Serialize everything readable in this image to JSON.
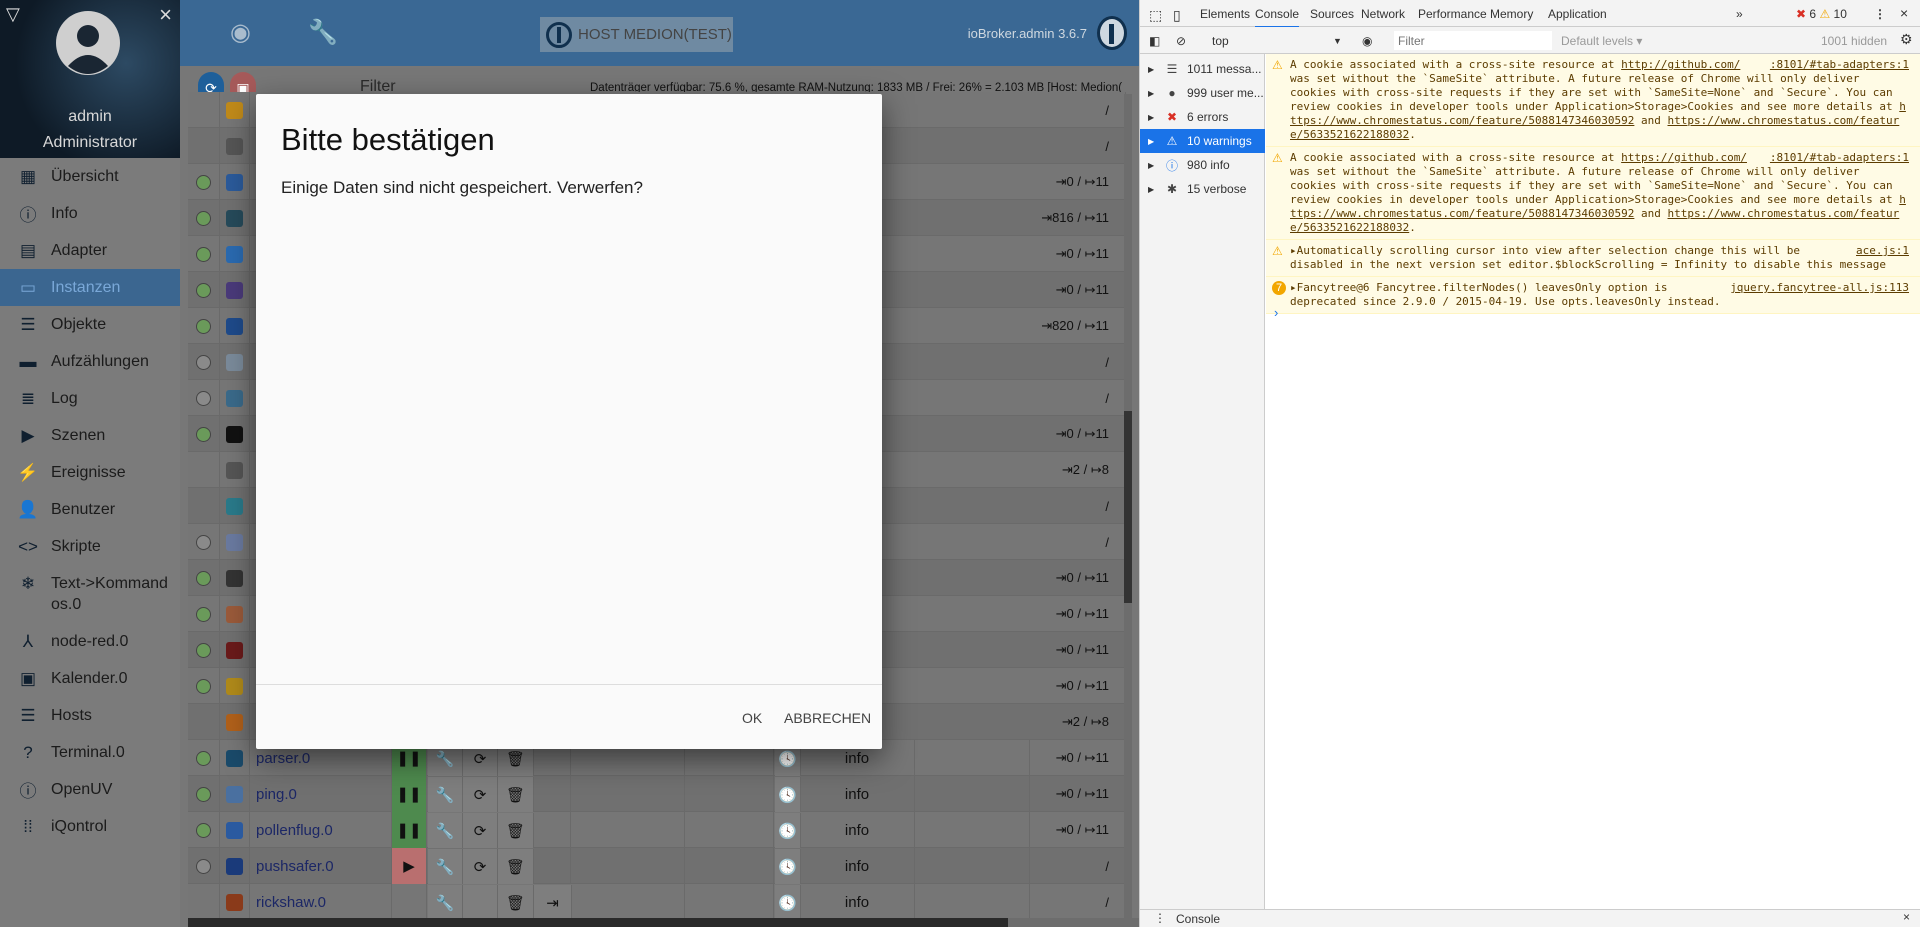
{
  "sidebar": {
    "user": "admin",
    "role": "Administrator",
    "items": [
      {
        "label": "Übersicht",
        "icon": "apps-icon",
        "g": "▦"
      },
      {
        "label": "Info",
        "icon": "info-icon",
        "g": "ⓘ"
      },
      {
        "label": "Adapter",
        "icon": "store-icon",
        "g": "▤"
      },
      {
        "label": "Instanzen",
        "icon": "instances-icon",
        "g": "▭",
        "active": true
      },
      {
        "label": "Objekte",
        "icon": "list-icon",
        "g": "☰"
      },
      {
        "label": "Aufzählungen",
        "icon": "enum-icon",
        "g": "▬"
      },
      {
        "label": "Log",
        "icon": "log-icon",
        "g": "≣"
      },
      {
        "label": "Szenen",
        "icon": "scenes-icon",
        "g": "▶"
      },
      {
        "label": "Ereignisse",
        "icon": "flash-icon",
        "g": "⚡"
      },
      {
        "label": "Benutzer",
        "icon": "user-icon",
        "g": "👤"
      },
      {
        "label": "Skripte",
        "icon": "code-icon",
        "g": "<>"
      },
      {
        "label": "Text->Kommandos.0",
        "icon": "snowflake-icon",
        "g": "❄",
        "two": true
      },
      {
        "label": "node-red.0",
        "icon": "node-red-icon",
        "g": "⅄"
      },
      {
        "label": "Kalender.0",
        "icon": "calendar-icon",
        "g": "▣"
      },
      {
        "label": "Hosts",
        "icon": "hosts-icon",
        "g": "☰"
      },
      {
        "label": "Terminal.0",
        "icon": "terminal-icon",
        "g": "?"
      },
      {
        "label": "OpenUV",
        "icon": "info-icon",
        "g": "ⓘ"
      },
      {
        "label": "iQontrol",
        "icon": "grid-dots-icon",
        "g": "⁞⁞"
      }
    ]
  },
  "header": {
    "host_label": "HOST MEDION(TEST)",
    "version": "ioBroker.admin 3.6.7"
  },
  "toolbar": {
    "filter_label": "Filter",
    "stats": "Datenträger verfügbar: 75.6 %, gesamte RAM-Nutzung: 1833 MB / Frei: 26% = 2.103 MB [Host: Medion("
  },
  "colors": {
    "green": "#6a9a5a",
    "grey": "#8a8a8a",
    "pause": "#4e8a4e",
    "play": "#b96f6f",
    "header": "#3a6894"
  },
  "rows": [
    {
      "status": "none",
      "icon": "#c08a1a",
      "values": "/"
    },
    {
      "status": "none",
      "icon": "#555",
      "values": "/"
    },
    {
      "status": "green",
      "icon": "#2b5a9a",
      "values": "⇥0 / ↦11"
    },
    {
      "status": "green",
      "icon": "#264a5a",
      "values": "⇥816 / ↦11"
    },
    {
      "status": "green",
      "icon": "#2a6ab0",
      "values": "⇥0 / ↦11"
    },
    {
      "status": "green",
      "icon": "#4a3a7a",
      "values": "⇥0 / ↦11"
    },
    {
      "status": "green",
      "icon": "#1e4a8a",
      "values": "⇥820 / ↦11"
    },
    {
      "status": "grey",
      "icon": "#7a8a9a",
      "values": "/"
    },
    {
      "status": "grey",
      "icon": "#3a6a8a",
      "values": "/"
    },
    {
      "status": "green",
      "icon": "#111",
      "values": "⇥0 / ↦11"
    },
    {
      "status": "none",
      "icon": "#555",
      "values": "⇥2 / ↦8"
    },
    {
      "status": "none",
      "icon": "#2a7a8a",
      "values": "/"
    },
    {
      "status": "grey",
      "icon": "#6a7aa0",
      "values": "/"
    },
    {
      "status": "green",
      "icon": "#333",
      "values": "⇥0 / ↦11"
    },
    {
      "status": "green",
      "icon": "#9a5a3a",
      "values": "⇥0 / ↦11"
    },
    {
      "status": "green",
      "icon": "#6a1a1a",
      "values": "⇥0 / ↦11"
    },
    {
      "status": "green",
      "icon": "#b08a1a",
      "values": "⇥0 / ↦11"
    },
    {
      "status": "none",
      "icon": "#b0601a",
      "values": "⇥2 / ↦8"
    },
    {
      "status": "green",
      "icon": "#1a4a6a",
      "name": "parser.0",
      "run": "pause",
      "values": "⇥0 / ↦11",
      "log": "info"
    },
    {
      "status": "green",
      "icon": "#4a70a0",
      "name": "ping.0",
      "run": "pause",
      "values": "⇥0 / ↦11",
      "log": "info"
    },
    {
      "status": "green",
      "icon": "#2a5aa0",
      "name": "pollenflug.0",
      "run": "pause",
      "values": "⇥0 / ↦11",
      "log": "info"
    },
    {
      "status": "grey",
      "icon": "#1a3a7a",
      "name": "pushsafer.0",
      "run": "play",
      "values": "/",
      "log": "info"
    },
    {
      "status": "none",
      "icon": "#8a3a1a",
      "name": "rickshaw.0",
      "run": "none",
      "values": "/",
      "log": "info"
    }
  ],
  "dialog": {
    "title": "Bitte bestätigen",
    "body": "Einige Daten sind nicht gespeichert. Verwerfen?",
    "ok": "OK",
    "cancel": "ABBRECHEN"
  },
  "devtools": {
    "tabs": [
      "Elements",
      "Console",
      "Sources",
      "Network",
      "Performance",
      "Memory",
      "Application"
    ],
    "more": "»",
    "error_count": "6",
    "warning_count": "10",
    "context": "top",
    "filter_placeholder": "Filter",
    "levels": "Default levels ▾",
    "hidden": "1001 hidden",
    "sidebar": [
      {
        "label": "1011 messa...",
        "icon": "list-icon",
        "g": "☰"
      },
      {
        "label": "999 user me...",
        "icon": "user-circle-icon",
        "g": "●"
      },
      {
        "label": "6 errors",
        "icon": "error-icon",
        "g": "✖"
      },
      {
        "label": "10 warnings",
        "icon": "warning-icon",
        "g": "⚠",
        "sel": true
      },
      {
        "label": "980 info",
        "icon": "info-icon",
        "g": "ⓘ"
      },
      {
        "label": "15 verbose",
        "icon": "bug-icon",
        "g": "✱"
      }
    ],
    "messages": [
      {
        "badge": "⚠",
        "src": ":8101/#tab-adapters:1",
        "pre": "A cookie associated with a cross-site resource at ",
        "link1": "http://github.com/",
        "mid": " was set without the `SameSite` attribute. A future release of Chrome will only deliver cookies with cross-site requests if they are set with `SameSite=None` and `Secure`. You can review cookies in developer tools under Application>Storage>Cookies and see more details at ",
        "link2": "https://www.chromestatus.com/feature/5088147346030592",
        "and": " and ",
        "link3": "https://www.chromestatus.com/feature/5633521622188032",
        "end": "."
      },
      {
        "badge": "⚠",
        "src": ":8101/#tab-adapters:1",
        "pre": "A cookie associated with a cross-site resource at ",
        "link1": "https://github.com/",
        "mid": " was set without the `SameSite` attribute. A future release of Chrome will only deliver cookies with cross-site requests if they are set with `SameSite=None` and `Secure`. You can review cookies in developer tools under Application>Storage>Cookies and see more details at ",
        "link2": "https://www.chromestatus.com/feature/5088147346030592",
        "and": " and ",
        "link3": "https://www.chromestatus.com/feature/5633521622188032",
        "end": "."
      },
      {
        "badge": "⚠",
        "src": "ace.js:1",
        "pre": "▸Automatically scrolling cursor into view after selection change this will be disabled in the next version set editor.$blockScrolling = Infinity to disable this message"
      },
      {
        "badge": "7",
        "src": "jquery.fancytree-all.js:113",
        "pre": "▸Fancytree@6 Fancytree.filterNodes() leavesOnly option is deprecated since 2.9.0 / 2015-04-19. Use opts.leavesOnly instead."
      }
    ],
    "prompt": "›",
    "drawer_label": "Console"
  }
}
